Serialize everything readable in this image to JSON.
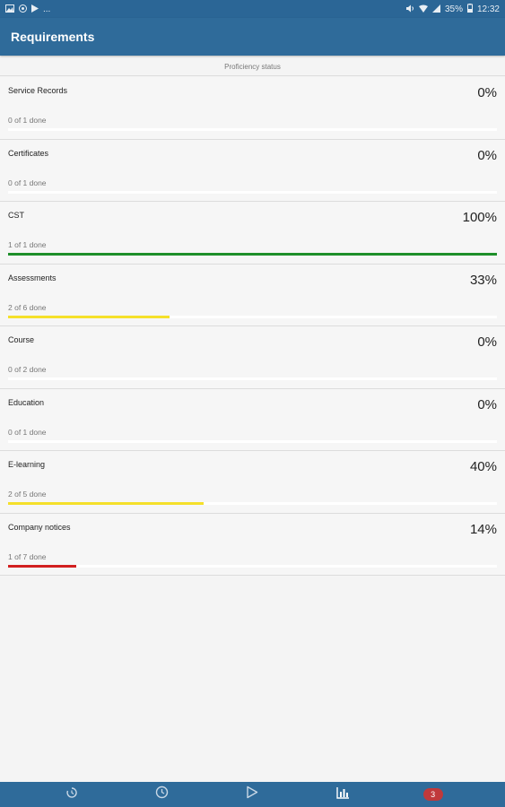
{
  "status_bar": {
    "left_icons": [
      "image-icon",
      "circle-c-icon",
      "play-store-icon"
    ],
    "left_more": "...",
    "battery": "35%",
    "time": "12:32"
  },
  "app_bar": {
    "title": "Requirements"
  },
  "subheader": {
    "label": "Proficiency status"
  },
  "requirements": [
    {
      "title": "Service Records",
      "percent": "0%",
      "done": "0 of 1 done",
      "progress": 0.0,
      "color": "#e2e2e2"
    },
    {
      "title": "Certificates",
      "percent": "0%",
      "done": "0 of 1 done",
      "progress": 0.0,
      "color": "#e2e2e2"
    },
    {
      "title": "CST",
      "percent": "100%",
      "done": "1 of 1 done",
      "progress": 1.0,
      "color": "#1e8f2a"
    },
    {
      "title": "Assessments",
      "percent": "33%",
      "done": "2 of 6 done",
      "progress": 0.33,
      "color": "#f5e02a"
    },
    {
      "title": "Course",
      "percent": "0%",
      "done": "0 of 2 done",
      "progress": 0.0,
      "color": "#e2e2e2"
    },
    {
      "title": "Education",
      "percent": "0%",
      "done": "0 of 1 done",
      "progress": 0.0,
      "color": "#e2e2e2"
    },
    {
      "title": "E-learning",
      "percent": "40%",
      "done": "2 of 5 done",
      "progress": 0.4,
      "color": "#f5e02a"
    },
    {
      "title": "Company notices",
      "percent": "14%",
      "done": "1 of 7 done",
      "progress": 0.14,
      "color": "#d21f1f"
    }
  ],
  "bottom_nav": {
    "items": [
      "history-icon",
      "clock-icon",
      "play-icon",
      "bar-chart-icon",
      "notifications-badge"
    ],
    "badge_count": "3"
  }
}
